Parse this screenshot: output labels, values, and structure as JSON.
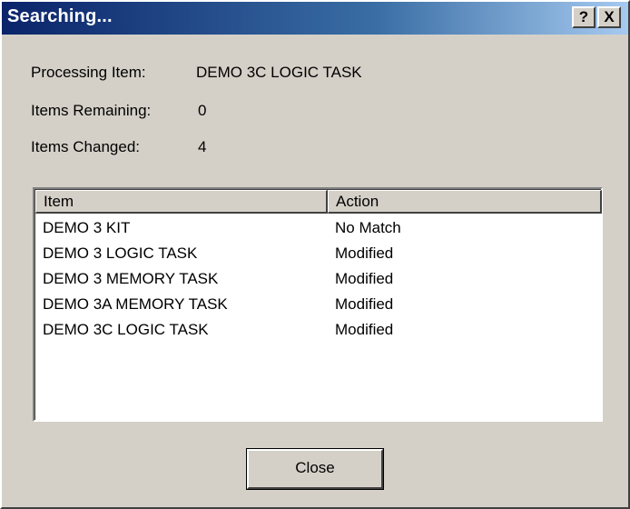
{
  "window": {
    "title": "Searching...",
    "help_button": "?",
    "close_button": "X"
  },
  "info": {
    "processing_label": "Processing Item:",
    "processing_value": "DEMO 3C LOGIC TASK",
    "remaining_label": "Items Remaining:",
    "remaining_value": "0",
    "changed_label": "Items Changed:",
    "changed_value": "4"
  },
  "list": {
    "columns": [
      "Item",
      "Action"
    ],
    "rows": [
      {
        "item": "DEMO 3 KIT",
        "action": "No Match"
      },
      {
        "item": "DEMO 3 LOGIC TASK",
        "action": "Modified"
      },
      {
        "item": "DEMO 3 MEMORY TASK",
        "action": "Modified"
      },
      {
        "item": "DEMO 3A MEMORY TASK",
        "action": "Modified"
      },
      {
        "item": "DEMO 3C LOGIC TASK",
        "action": "Modified"
      }
    ]
  },
  "buttons": {
    "close_label": "Close"
  }
}
